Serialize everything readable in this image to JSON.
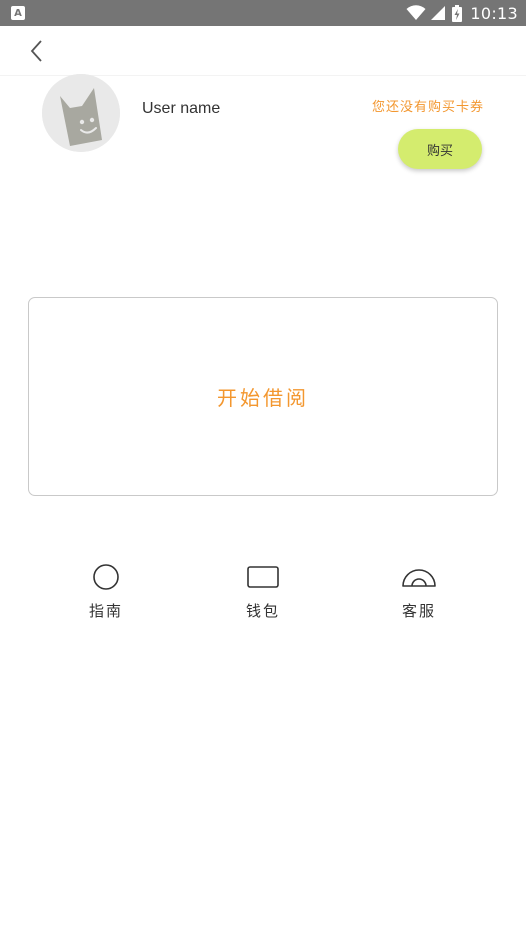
{
  "status_bar": {
    "time": "10:13",
    "left_icon": "notification-a-icon",
    "icons": [
      "wifi-icon",
      "signal-icon",
      "battery-charging-icon"
    ]
  },
  "nav": {
    "back_icon": "chevron-left-icon"
  },
  "profile": {
    "username": "User name",
    "avatar_icon": "cat-face-avatar",
    "no_card_message": "您还没有购买卡券",
    "buy_label": "购买"
  },
  "borrow_card": {
    "label": "开始借阅"
  },
  "shortcuts": [
    {
      "label": "指南",
      "icon": "circle-icon"
    },
    {
      "label": "钱包",
      "icon": "wallet-rectangle-icon"
    },
    {
      "label": "客服",
      "icon": "headset-arc-icon"
    }
  ],
  "colors": {
    "accent_orange": "#f3972f",
    "buy_button_green": "#d4ec6e",
    "status_bar": "#757575"
  }
}
